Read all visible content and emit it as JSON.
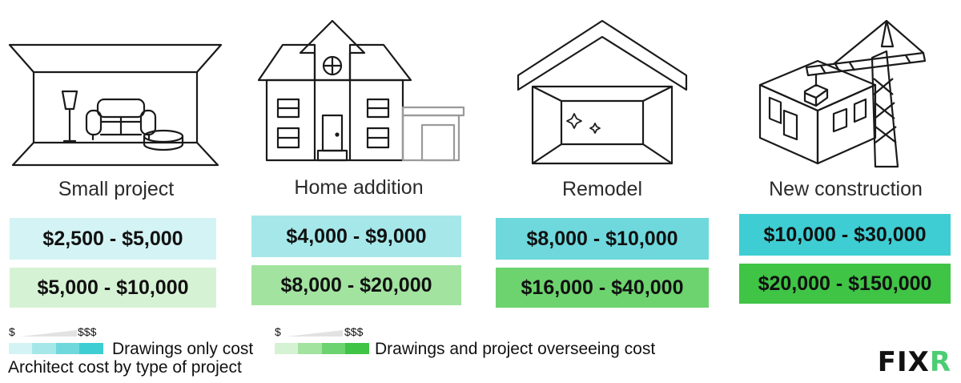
{
  "chart_data": {
    "type": "bar",
    "title": "",
    "categories": [
      "Small project",
      "Home addition",
      "Remodel",
      "New construction"
    ],
    "series": [
      {
        "name": "Drawings only cost",
        "ranges": [
          [
            2500,
            5000
          ],
          [
            4000,
            9000
          ],
          [
            8000,
            10000
          ],
          [
            10000,
            30000
          ]
        ],
        "labels": [
          "$2,500 - $5,000",
          "$4,000 - $9,000",
          "$8,000 - $10,000",
          "$10,000 - $30,000"
        ],
        "colors": [
          "#d4f3f4",
          "#a6e8ea",
          "#6ed8dc",
          "#3dcdd2"
        ]
      },
      {
        "name": "Drawings and project overseeing cost",
        "ranges": [
          [
            5000,
            10000
          ],
          [
            8000,
            20000
          ],
          [
            16000,
            40000
          ],
          [
            20000,
            150000
          ]
        ],
        "labels": [
          "$5,000 - $10,000",
          "$8,000 - $20,000",
          "$16,000 - $40,000",
          "$20,000 - $150,000"
        ],
        "colors": [
          "#d6f2d4",
          "#a2e3a0",
          "#6dd36e",
          "#3fc445"
        ]
      }
    ]
  },
  "legend": {
    "low": "$",
    "high": "$$$"
  },
  "footer_caption": "Architect cost by type of project",
  "logo_text": "FIXR",
  "logo_main": "FIX",
  "logo_accent": "R"
}
